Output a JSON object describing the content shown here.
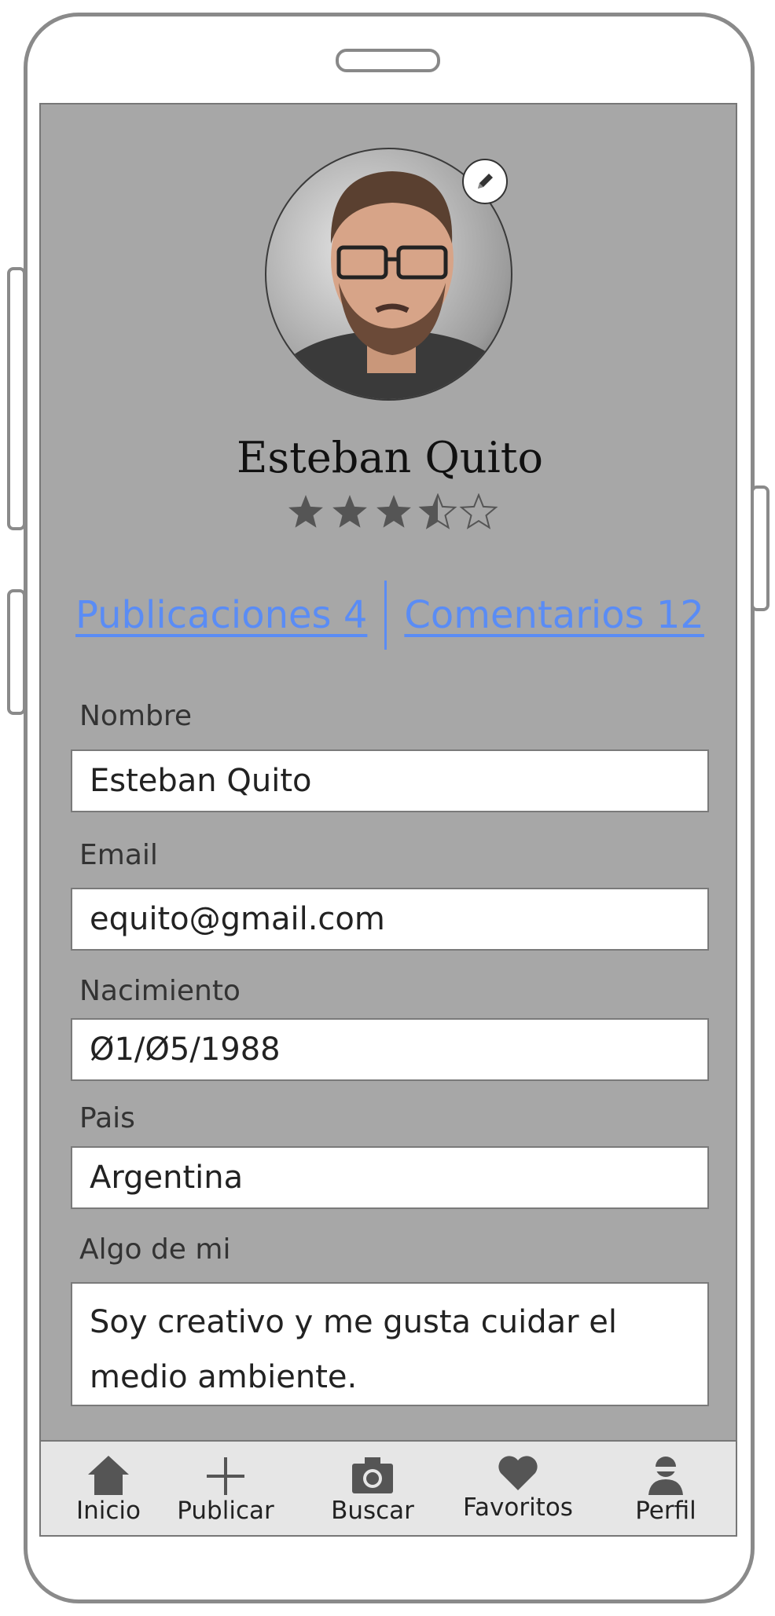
{
  "profile": {
    "name": "Esteban Quito",
    "rating": 3.5,
    "rating_max": 5
  },
  "stats": {
    "posts_label": "Publicaciones 4",
    "comments_label": "Comentarios 12"
  },
  "form": {
    "name_label": "Nombre",
    "name_value": "Esteban Quito",
    "email_label": "Email",
    "email_value": "equito@gmail.com",
    "birth_label": "Nacimiento",
    "birth_value": "Ø1/Ø5/1988",
    "country_label": "Pais",
    "country_value": "Argentina",
    "about_label": "Algo de mi",
    "about_value": "Soy creativo y me gusta cuidar el medio ambiente."
  },
  "tabbar": {
    "items": [
      {
        "label": "Inicio",
        "icon": "home-icon"
      },
      {
        "label": "Publicar",
        "icon": "plus-icon"
      },
      {
        "label": "Buscar",
        "icon": "camera-icon"
      },
      {
        "label": "Favoritos",
        "icon": "heart-icon"
      },
      {
        "label": "Perfil",
        "icon": "user-icon"
      }
    ]
  },
  "colors": {
    "screen_bg": "#a7a7a7",
    "link": "#5a8cf5",
    "tabbar_bg": "#e6e6e6",
    "icon": "#555555"
  }
}
